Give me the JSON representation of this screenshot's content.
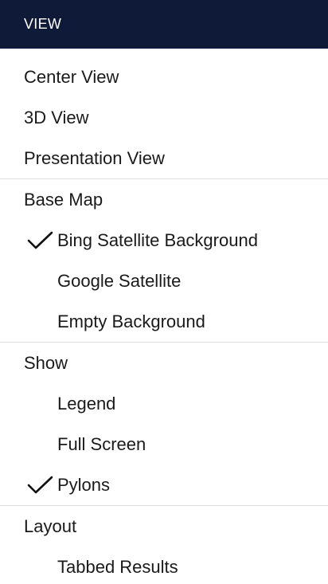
{
  "header": {
    "title": "VIEW"
  },
  "sections": [
    {
      "items": [
        "Center View",
        "3D View",
        "Presentation View"
      ]
    },
    {
      "heading": "Base Map",
      "items": [
        {
          "label": "Bing Satellite Background",
          "checked": true
        },
        {
          "label": "Google Satellite",
          "checked": false
        },
        {
          "label": "Empty Background",
          "checked": false
        }
      ]
    },
    {
      "heading": "Show",
      "items": [
        {
          "label": "Legend",
          "checked": false
        },
        {
          "label": "Full Screen",
          "checked": false
        },
        {
          "label": "Pylons",
          "checked": true
        }
      ]
    },
    {
      "heading": "Layout",
      "items": [
        {
          "label": "Tabbed Results",
          "checked": false
        }
      ]
    }
  ],
  "colors": {
    "header_bg": "#0f1a38",
    "header_text": "#ffffff",
    "text": "#1a1a1a",
    "divider": "#dedede"
  },
  "icons": {
    "checkmark": "checkmark-icon"
  }
}
